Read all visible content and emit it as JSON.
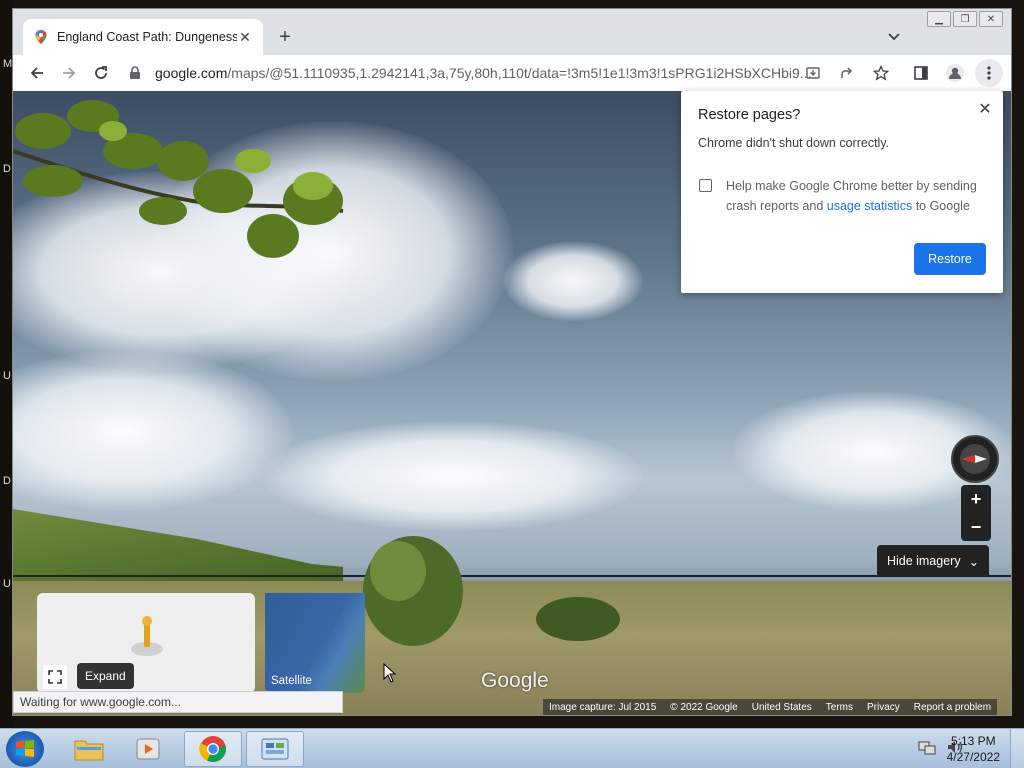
{
  "desktop": {
    "edge_letters": [
      "M",
      "D",
      "U",
      "D",
      "U"
    ]
  },
  "browser": {
    "tab_title": "England Coast Path: Dungeness",
    "url_host": "google.com",
    "url_path": "/maps/@51.1110935,1.2942141,3a,75y,80h,110t/data=!3m5!1e1!3m3!1sPRG1i2HSbXCHbi9...",
    "status_text": "Waiting for www.google.com..."
  },
  "restore_dialog": {
    "title": "Restore pages?",
    "message": "Chrome didn't shut down correctly.",
    "checkbox_text_pre": "Help make Google Chrome better by sending crash reports and ",
    "checkbox_link": "usage statistics",
    "checkbox_text_post": " to Google",
    "checkbox_checked": false,
    "restore_label": "Restore",
    "accent_color": "#1a73e8"
  },
  "street_view": {
    "hide_imagery_label": "Hide imagery",
    "expand_label": "Expand",
    "satellite_label": "Satellite",
    "google_logo": "Google",
    "zoom_in": "+",
    "zoom_out": "−",
    "footer": {
      "image_capture": "Image capture: Jul 2015",
      "copyright": "© 2022 Google",
      "region": "United States",
      "terms": "Terms",
      "privacy": "Privacy",
      "report": "Report a problem"
    }
  },
  "taskbar": {
    "time": "5:13 PM",
    "date": "4/27/2022"
  }
}
